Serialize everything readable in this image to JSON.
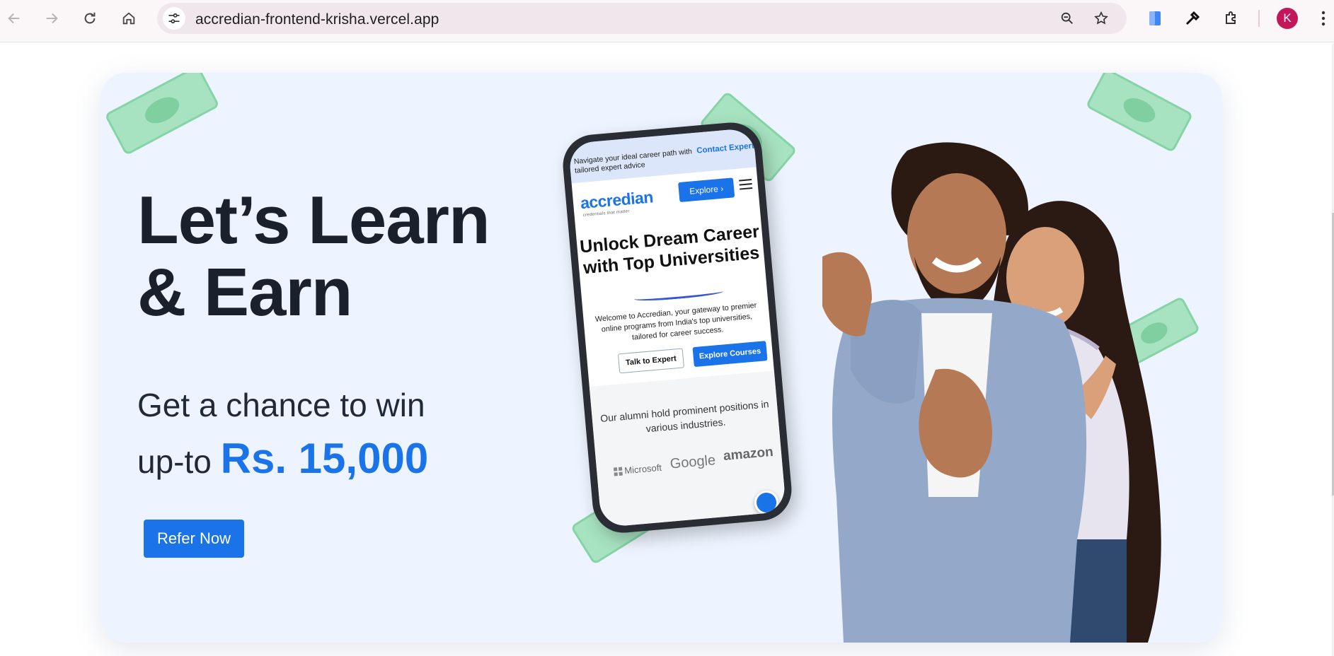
{
  "browser": {
    "url": "accredian-frontend-krisha.vercel.app",
    "profile_initial": "K"
  },
  "hero": {
    "headline_line1": "Let’s Learn",
    "headline_line2": "& Earn",
    "subhead_line1": "Get a chance to win",
    "subhead_prefix": "up-to",
    "prize": "Rs. 15,000",
    "cta_label": "Refer Now"
  },
  "phone": {
    "topbar_text": "Navigate your ideal career path with tailored expert advice",
    "contact_label": "Contact Expert",
    "logo": "accredian",
    "tagline": "credentials that matter",
    "explore_label": "Explore",
    "hero_title": "Unlock Dream Career with Top Universities",
    "welcome_text": "Welcome to Accredian, your gateway to premier online programs from India's top universities, tailored for career success.",
    "talk_label": "Talk to Expert",
    "courses_label": "Explore Courses",
    "alumni_text": "Our alumni hold prominent positions in various industries.",
    "brands": [
      "Microsoft",
      "Google",
      "amazon"
    ]
  },
  "colors": {
    "accent": "#1a73e8",
    "card_bg": "#eef4ff",
    "headline": "#1a202c",
    "money_green": "#a7e3c0"
  }
}
